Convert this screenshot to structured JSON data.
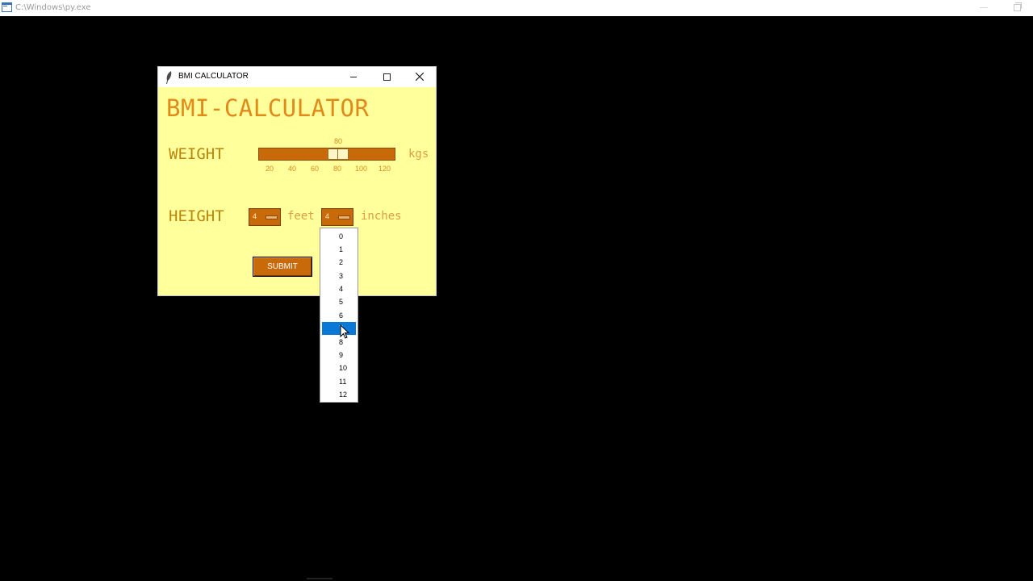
{
  "console": {
    "title": "C:\\Windows\\py.exe"
  },
  "window": {
    "title": "BMI CALCULATOR"
  },
  "app": {
    "heading": "BMI-CALCULATOR",
    "weight_label": "WEIGHT",
    "height_label": "HEIGHT",
    "weight_unit": "kgs",
    "feet_unit": "feet",
    "inches_unit": "inches",
    "submit_label": "SUBMIT"
  },
  "weight_scale": {
    "current_value": "80",
    "min": 20,
    "max": 120,
    "value": 80,
    "ticks": [
      "20",
      "40",
      "60",
      "80",
      "100",
      "120"
    ]
  },
  "height_feet": {
    "selected": "4"
  },
  "height_inches": {
    "selected": "4",
    "options": [
      "0",
      "1",
      "2",
      "3",
      "4",
      "5",
      "6",
      "7",
      "8",
      "9",
      "10",
      "11",
      "12"
    ],
    "highlighted": "7"
  },
  "colors": {
    "background": "#ffff9c",
    "accent": "#c96a0a",
    "heading": "#e08a1a",
    "selection": "#0a78d7"
  }
}
